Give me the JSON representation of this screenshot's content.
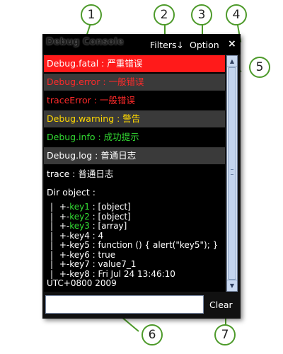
{
  "window": {
    "title": "Debug Console",
    "filters_label": "Filters↓",
    "option_label": "Option",
    "close_label": "×"
  },
  "entries": [
    {
      "text": "Debug.fatal : 严重错误",
      "level": "fatal"
    },
    {
      "text": "Debug.error : 一般错误",
      "level": "error"
    },
    {
      "text": "traceError : 一般错误",
      "level": "trace-error"
    },
    {
      "text": "Debug.warning : 警告",
      "level": "warning"
    },
    {
      "text": "Debug.info : 成功提示",
      "level": "info"
    },
    {
      "text": "Debug.log : 普通日志",
      "level": "log"
    },
    {
      "text": "trace : 普通日志",
      "level": "trace"
    }
  ],
  "dir": {
    "header": "Dir object :",
    "lines": [
      {
        "key": "key1",
        "value": "[object]"
      },
      {
        "key": "key2",
        "value": "[object]"
      },
      {
        "key": "key3",
        "value": "[array]"
      },
      {
        "key": "key4",
        "value": "4"
      },
      {
        "key": "key5",
        "value": "function () { alert(\"key5\"); }"
      },
      {
        "key": "key6",
        "value": "true"
      },
      {
        "key": "key7",
        "value": "value7_1"
      },
      {
        "key": "key8",
        "value": "Fri Jul 24 13:46:10"
      }
    ],
    "trailing": "UTC+0800 2009"
  },
  "footer": {
    "input_value": "",
    "clear_label": "Clear"
  },
  "callouts": [
    "1",
    "2",
    "3",
    "4",
    "5",
    "6",
    "7"
  ],
  "colors": {
    "callout": "#4d9a2a",
    "fatal_bg": "#ff1a1a",
    "error_text": "#ff2a2a",
    "warning_text": "#ffd800",
    "info_text": "#33dd33"
  }
}
